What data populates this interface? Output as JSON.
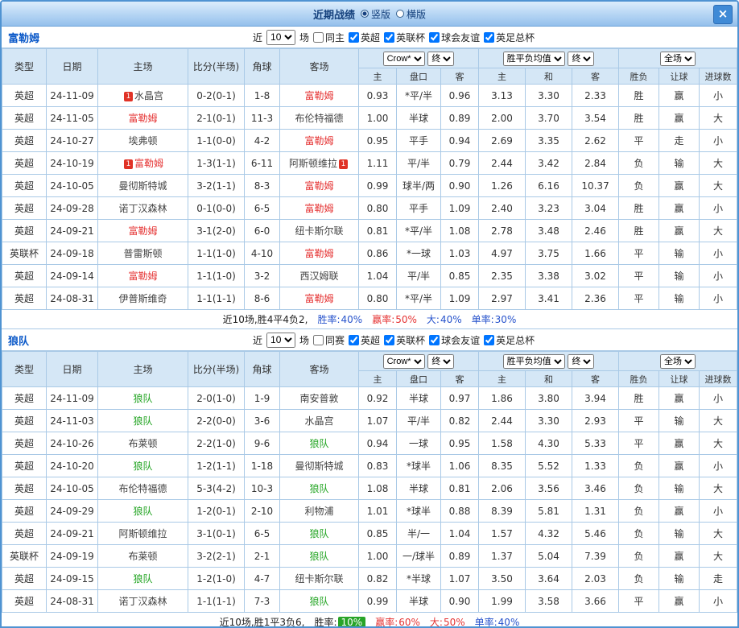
{
  "titlebar": {
    "title": "近期战绩",
    "layout_options": [
      {
        "label": "竖版",
        "selected": true
      },
      {
        "label": "横版",
        "selected": false
      }
    ],
    "close_label": "×"
  },
  "controls": {
    "near": "近",
    "count": "10",
    "games": "场",
    "bookmaker": "Crow*",
    "final": "终",
    "avg": "胜平负均值",
    "final2": "终",
    "scope": "全场"
  },
  "columns": {
    "type": "类型",
    "date": "日期",
    "home": "主场",
    "score": "比分(半场)",
    "corner": "角球",
    "away": "客场",
    "sub": [
      "主",
      "盘口",
      "客",
      "主",
      "和",
      "客",
      "胜负",
      "让球",
      "进球数"
    ]
  },
  "colors": {
    "accent_blue": "#2753cc",
    "win_red": "#e53333",
    "lose_green": "#1fa31f",
    "league_badge_red": "#f0382b",
    "league_badge_gray": "#909090",
    "focal_home_team": "#e53333",
    "focal_away_team": "#1fa31f",
    "win_rate_badge_green": "#28a428",
    "header_bg": "#d5e7f6",
    "border_blue": "#4f93d2"
  },
  "sections": [
    {
      "team": "富勒姆",
      "team_color": "#e53333",
      "same_filter": {
        "label": "同主",
        "checked": false
      },
      "league_filters": [
        {
          "label": "英超",
          "checked": true
        },
        {
          "label": "英联杯",
          "checked": true
        },
        {
          "label": "球会友谊",
          "checked": true
        },
        {
          "label": "英足总杯",
          "checked": true
        }
      ],
      "rows": [
        {
          "lg": "英超",
          "lgk": "red",
          "d": "24-11-09",
          "hcard": "1",
          "h": "水晶宫",
          "hk": "opp",
          "s": "0-2(0-1)",
          "cr": "1-8",
          "a": "富勒姆",
          "ak": "focal",
          "acard": "",
          "o1": "0.93",
          "hd": "*平/半",
          "o2": "0.96",
          "m1": "3.13",
          "m2": "3.30",
          "m3": "2.33",
          "r1": "胜",
          "k1": "w",
          "r2": "赢",
          "k2": "w",
          "r3": "小",
          "k3": "l"
        },
        {
          "lg": "英超",
          "lgk": "red",
          "d": "24-11-05",
          "hcard": "",
          "h": "富勒姆",
          "hk": "focal",
          "s": "2-1(0-1)",
          "cr": "11-3",
          "a": "布伦特福德",
          "ak": "opp",
          "acard": "",
          "o1": "1.00",
          "hd": "半球",
          "o2": "0.89",
          "m1": "2.00",
          "m2": "3.70",
          "m3": "3.54",
          "r1": "胜",
          "k1": "w",
          "r2": "赢",
          "k2": "w",
          "r3": "大",
          "k3": "w"
        },
        {
          "lg": "英超",
          "lgk": "red",
          "d": "24-10-27",
          "hcard": "",
          "h": "埃弗顿",
          "hk": "opp",
          "s": "1-1(0-0)",
          "cr": "4-2",
          "a": "富勒姆",
          "ak": "focal",
          "acard": "",
          "o1": "0.95",
          "hd": "平手",
          "o2": "0.94",
          "m1": "2.69",
          "m2": "3.35",
          "m3": "2.62",
          "r1": "平",
          "k1": "d",
          "r2": "走",
          "k2": "d",
          "r3": "小",
          "k3": "l"
        },
        {
          "lg": "英超",
          "lgk": "red",
          "d": "24-10-19",
          "hcard": "1",
          "h": "富勒姆",
          "hk": "focal",
          "s": "1-3(1-1)",
          "cr": "6-11",
          "a": "阿斯顿维拉",
          "ak": "opp",
          "acard": "1",
          "o1": "1.11",
          "hd": "平/半",
          "o2": "0.79",
          "m1": "2.44",
          "m2": "3.42",
          "m3": "2.84",
          "r1": "负",
          "k1": "l",
          "r2": "输",
          "k2": "l",
          "r3": "大",
          "k3": "w"
        },
        {
          "lg": "英超",
          "lgk": "red",
          "d": "24-10-05",
          "hcard": "",
          "h": "曼彻斯特城",
          "hk": "opp",
          "s": "3-2(1-1)",
          "cr": "8-3",
          "a": "富勒姆",
          "ak": "focal",
          "acard": "",
          "o1": "0.99",
          "hd": "球半/两",
          "o2": "0.90",
          "m1": "1.26",
          "m2": "6.16",
          "m3": "10.37",
          "r1": "负",
          "k1": "l",
          "r2": "赢",
          "k2": "w",
          "r3": "大",
          "k3": "w"
        },
        {
          "lg": "英超",
          "lgk": "red",
          "d": "24-09-28",
          "hcard": "",
          "h": "诺丁汉森林",
          "hk": "opp",
          "s": "0-1(0-0)",
          "cr": "6-5",
          "a": "富勒姆",
          "ak": "focal",
          "acard": "",
          "o1": "0.80",
          "hd": "平手",
          "o2": "1.09",
          "m1": "2.40",
          "m2": "3.23",
          "m3": "3.04",
          "r1": "胜",
          "k1": "w",
          "r2": "赢",
          "k2": "w",
          "r3": "小",
          "k3": "l"
        },
        {
          "lg": "英超",
          "lgk": "red",
          "d": "24-09-21",
          "hcard": "",
          "h": "富勒姆",
          "hk": "focal",
          "s": "3-1(2-0)",
          "cr": "6-0",
          "a": "纽卡斯尔联",
          "ak": "opp",
          "acard": "",
          "o1": "0.81",
          "hd": "*平/半",
          "o2": "1.08",
          "m1": "2.78",
          "m2": "3.48",
          "m3": "2.46",
          "r1": "胜",
          "k1": "w",
          "r2": "赢",
          "k2": "w",
          "r3": "大",
          "k3": "w"
        },
        {
          "lg": "英联杯",
          "lgk": "gray",
          "d": "24-09-18",
          "hcard": "",
          "h": "普雷斯顿",
          "hk": "opp",
          "s": "1-1(1-0)",
          "cr": "4-10",
          "a": "富勒姆",
          "ak": "focal",
          "acard": "",
          "o1": "0.86",
          "hd": "*一球",
          "o2": "1.03",
          "m1": "4.97",
          "m2": "3.75",
          "m3": "1.66",
          "r1": "平",
          "k1": "d",
          "r2": "输",
          "k2": "l",
          "r3": "小",
          "k3": "l"
        },
        {
          "lg": "英超",
          "lgk": "red",
          "d": "24-09-14",
          "hcard": "",
          "h": "富勒姆",
          "hk": "focal",
          "s": "1-1(1-0)",
          "cr": "3-2",
          "a": "西汉姆联",
          "ak": "opp",
          "acard": "",
          "o1": "1.04",
          "hd": "平/半",
          "o2": "0.85",
          "m1": "2.35",
          "m2": "3.38",
          "m3": "3.02",
          "r1": "平",
          "k1": "d",
          "r2": "输",
          "k2": "l",
          "r3": "小",
          "k3": "l"
        },
        {
          "lg": "英超",
          "lgk": "red",
          "d": "24-08-31",
          "hcard": "",
          "h": "伊普斯维奇",
          "hk": "opp",
          "s": "1-1(1-1)",
          "cr": "8-6",
          "a": "富勒姆",
          "ak": "focal",
          "acard": "",
          "o1": "0.80",
          "hd": "*平/半",
          "o2": "1.09",
          "m1": "2.97",
          "m2": "3.41",
          "m3": "2.36",
          "r1": "平",
          "k1": "d",
          "r2": "输",
          "k2": "l",
          "r3": "小",
          "k3": "l"
        }
      ],
      "summary": {
        "record": "近10场,胜4平4负2,",
        "stats": [
          {
            "label": "胜率:",
            "value": "40%",
            "style": "blue"
          },
          {
            "label": "赢率:",
            "value": "50%",
            "style": "red"
          },
          {
            "label": "大:",
            "value": "40%",
            "style": "blue"
          },
          {
            "label": "单率:",
            "value": "30%",
            "style": "blue"
          }
        ]
      }
    },
    {
      "team": "狼队",
      "team_color": "#1fa31f",
      "same_filter": {
        "label": "同赛",
        "checked": false
      },
      "league_filters": [
        {
          "label": "英超",
          "checked": true
        },
        {
          "label": "英联杯",
          "checked": true
        },
        {
          "label": "球会友谊",
          "checked": true
        },
        {
          "label": "英足总杯",
          "checked": true
        }
      ],
      "rows": [
        {
          "lg": "英超",
          "lgk": "red",
          "d": "24-11-09",
          "hcard": "",
          "h": "狼队",
          "hk": "focal",
          "s": "2-0(1-0)",
          "cr": "1-9",
          "a": "南安普敦",
          "ak": "opp",
          "acard": "",
          "o1": "0.92",
          "hd": "半球",
          "o2": "0.97",
          "m1": "1.86",
          "m2": "3.80",
          "m3": "3.94",
          "r1": "胜",
          "k1": "w",
          "r2": "赢",
          "k2": "w",
          "r3": "小",
          "k3": "l"
        },
        {
          "lg": "英超",
          "lgk": "red",
          "d": "24-11-03",
          "hcard": "",
          "h": "狼队",
          "hk": "focal",
          "s": "2-2(0-0)",
          "cr": "3-6",
          "a": "水晶宫",
          "ak": "opp",
          "acard": "",
          "o1": "1.07",
          "hd": "平/半",
          "o2": "0.82",
          "m1": "2.44",
          "m2": "3.30",
          "m3": "2.93",
          "r1": "平",
          "k1": "d",
          "r2": "输",
          "k2": "l",
          "r3": "大",
          "k3": "w"
        },
        {
          "lg": "英超",
          "lgk": "red",
          "d": "24-10-26",
          "hcard": "",
          "h": "布莱顿",
          "hk": "opp",
          "s": "2-2(1-0)",
          "cr": "9-6",
          "a": "狼队",
          "ak": "focal",
          "acard": "",
          "o1": "0.94",
          "hd": "一球",
          "o2": "0.95",
          "m1": "1.58",
          "m2": "4.30",
          "m3": "5.33",
          "r1": "平",
          "k1": "d",
          "r2": "赢",
          "k2": "w",
          "r3": "大",
          "k3": "w"
        },
        {
          "lg": "英超",
          "lgk": "red",
          "d": "24-10-20",
          "hcard": "",
          "h": "狼队",
          "hk": "focal",
          "s": "1-2(1-1)",
          "cr": "1-18",
          "a": "曼彻斯特城",
          "ak": "opp",
          "acard": "",
          "o1": "0.83",
          "hd": "*球半",
          "o2": "1.06",
          "m1": "8.35",
          "m2": "5.52",
          "m3": "1.33",
          "r1": "负",
          "k1": "l",
          "r2": "赢",
          "k2": "w",
          "r3": "小",
          "k3": "l"
        },
        {
          "lg": "英超",
          "lgk": "red",
          "d": "24-10-05",
          "hcard": "",
          "h": "布伦特福德",
          "hk": "opp",
          "s": "5-3(4-2)",
          "cr": "10-3",
          "a": "狼队",
          "ak": "focal",
          "acard": "",
          "o1": "1.08",
          "hd": "半球",
          "o2": "0.81",
          "m1": "2.06",
          "m2": "3.56",
          "m3": "3.46",
          "r1": "负",
          "k1": "l",
          "r2": "输",
          "k2": "l",
          "r3": "大",
          "k3": "w"
        },
        {
          "lg": "英超",
          "lgk": "red",
          "d": "24-09-29",
          "hcard": "",
          "h": "狼队",
          "hk": "focal",
          "s": "1-2(0-1)",
          "cr": "2-10",
          "a": "利物浦",
          "ak": "opp",
          "acard": "",
          "o1": "1.01",
          "hd": "*球半",
          "o2": "0.88",
          "m1": "8.39",
          "m2": "5.81",
          "m3": "1.31",
          "r1": "负",
          "k1": "l",
          "r2": "赢",
          "k2": "w",
          "r3": "小",
          "k3": "l"
        },
        {
          "lg": "英超",
          "lgk": "red",
          "d": "24-09-21",
          "hcard": "",
          "h": "阿斯顿维拉",
          "hk": "opp",
          "s": "3-1(0-1)",
          "cr": "6-5",
          "a": "狼队",
          "ak": "focal",
          "acard": "",
          "o1": "0.85",
          "hd": "半/一",
          "o2": "1.04",
          "m1": "1.57",
          "m2": "4.32",
          "m3": "5.46",
          "r1": "负",
          "k1": "l",
          "r2": "输",
          "k2": "l",
          "r3": "大",
          "k3": "w"
        },
        {
          "lg": "英联杯",
          "lgk": "gray",
          "d": "24-09-19",
          "hcard": "",
          "h": "布莱顿",
          "hk": "opp",
          "s": "3-2(2-1)",
          "cr": "2-1",
          "a": "狼队",
          "ak": "focal",
          "acard": "",
          "o1": "1.00",
          "hd": "一/球半",
          "o2": "0.89",
          "m1": "1.37",
          "m2": "5.04",
          "m3": "7.39",
          "r1": "负",
          "k1": "l",
          "r2": "赢",
          "k2": "w",
          "r3": "大",
          "k3": "w"
        },
        {
          "lg": "英超",
          "lgk": "red",
          "d": "24-09-15",
          "hcard": "",
          "h": "狼队",
          "hk": "focal",
          "s": "1-2(1-0)",
          "cr": "4-7",
          "a": "纽卡斯尔联",
          "ak": "opp",
          "acard": "",
          "o1": "0.82",
          "hd": "*半球",
          "o2": "1.07",
          "m1": "3.50",
          "m2": "3.64",
          "m3": "2.03",
          "r1": "负",
          "k1": "l",
          "r2": "输",
          "k2": "l",
          "r3": "走",
          "k3": "d"
        },
        {
          "lg": "英超",
          "lgk": "red",
          "d": "24-08-31",
          "hcard": "",
          "h": "诺丁汉森林",
          "hk": "opp",
          "s": "1-1(1-1)",
          "cr": "7-3",
          "a": "狼队",
          "ak": "focal",
          "acard": "",
          "o1": "0.99",
          "hd": "半球",
          "o2": "0.90",
          "m1": "1.99",
          "m2": "3.58",
          "m3": "3.66",
          "r1": "平",
          "k1": "d",
          "r2": "赢",
          "k2": "w",
          "r3": "小",
          "k3": "l"
        }
      ],
      "summary": {
        "record": "近10场,胜1平3负6,",
        "stats": [
          {
            "label": "胜率:",
            "value": "10%",
            "style": "badge"
          },
          {
            "label": "赢率:",
            "value": "60%",
            "style": "red"
          },
          {
            "label": "大:",
            "value": "50%",
            "style": "red"
          },
          {
            "label": "单率:",
            "value": "40%",
            "style": "blue"
          }
        ]
      }
    }
  ]
}
